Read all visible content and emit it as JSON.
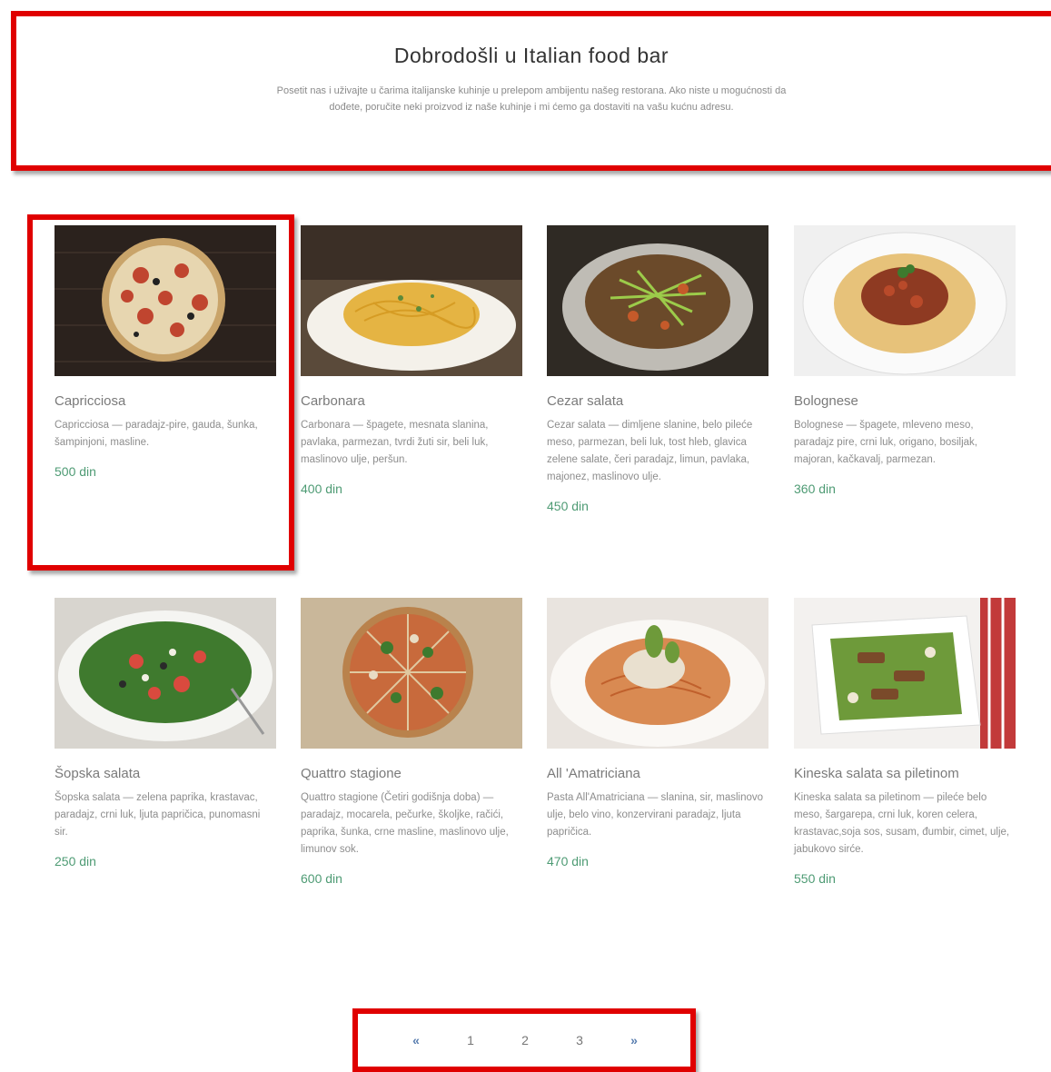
{
  "header": {
    "title": "Dobrodošli u Italian food bar",
    "intro": "Posetit nas i uživajte u čarima italijanske kuhinje u prelepom ambijentu našeg restorana. Ako niste u mogućnosti da dođete, poručite neki proizvod iz naše kuhinje i mi ćemo ga dostaviti na vašu kućnu adresu."
  },
  "products": [
    {
      "name": "Capricciosa",
      "desc": "Capricciosa — paradajz-pire, gauda, šunka, šampinjoni, masline.",
      "price": "500 din",
      "image": "pizza-capricciosa"
    },
    {
      "name": "Carbonara",
      "desc": "Carbonara — špagete, mesnata slanina, pavlaka, parmezan, tvrdi žuti sir, beli luk, maslinovo ulje, peršun.",
      "price": "400 din",
      "image": "pasta-carbonara"
    },
    {
      "name": "Cezar salata",
      "desc": "Cezar salata — dimljene slanine, belo pileće meso, parmezan, beli luk, tost hleb, glavica zelene salate, čeri paradajz, limun, pavlaka, majonez, maslinovo ulje.",
      "price": "450 din",
      "image": "caesar-salad"
    },
    {
      "name": "Bolognese",
      "desc": "Bolognese — špagete, mleveno meso, paradajz pire, crni luk, origano, bosiljak, majoran, kačkavalj, parmezan.",
      "price": "360 din",
      "image": "pasta-bolognese"
    },
    {
      "name": "Šopska salata",
      "desc": "Šopska salata — zelena paprika, krastavac, paradajz, crni luk, ljuta papričica, punomasni sir.",
      "price": "250 din",
      "image": "shopska-salad"
    },
    {
      "name": "Quattro stagione",
      "desc": "Quattro stagione (Četiri godišnja doba) — paradajz, mocarela, pečurke, školjke, račići, paprika, šunka, crne masline, maslinovo ulje, limunov sok.",
      "price": "600 din",
      "image": "pizza-quattro-stagioni"
    },
    {
      "name": "All 'Amatriciana",
      "desc": "Pasta All'Amatriciana — slanina, sir, maslinovo ulje, belo vino, konzervirani paradajz, ljuta papričica.",
      "price": "470 din",
      "image": "pasta-amatriciana"
    },
    {
      "name": "Kineska salata sa piletinom",
      "desc": "Kineska salata sa piletinom — pileće belo meso, šargarepa, crni luk, koren celera, krastavac,soja sos, susam, đumbir, cimet, ulje, jabukovo sirće.",
      "price": "550 din",
      "image": "chinese-chicken-salad"
    }
  ],
  "pagination": {
    "prev": "«",
    "pages": [
      "1",
      "2",
      "3"
    ],
    "next": "»"
  },
  "annotation_color": "#e00000"
}
